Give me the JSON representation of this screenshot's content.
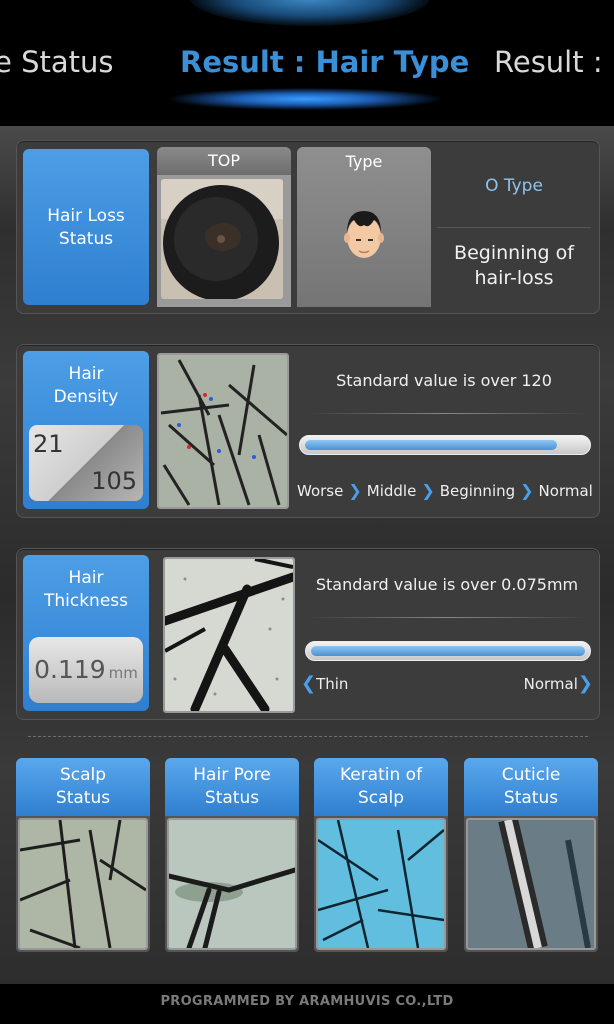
{
  "header": {
    "prev_tab": "le Status",
    "current_tab": "Result : Hair Type",
    "next_tab": "Result : H"
  },
  "hair_loss": {
    "label": "Hair Loss Status",
    "top_header": "TOP",
    "type_header": "Type",
    "type_value": "O Type",
    "stage": "Beginning of hair-loss"
  },
  "density": {
    "label": "Hair Density",
    "value_a": "21",
    "value_b": "105",
    "standard": "Standard value is over 120",
    "progress": 0.9,
    "scale": [
      "Worse",
      "Middle",
      "Beginning",
      "Normal"
    ]
  },
  "thickness": {
    "label": "Hair Thickness",
    "value": "0.119",
    "unit": "mm",
    "standard": "Standard value is over 0.075mm",
    "progress": 1.0,
    "left_end": "Thin",
    "right_end": "Normal"
  },
  "tiles": [
    {
      "label": "Scalp Status"
    },
    {
      "label": "Hair Pore Status"
    },
    {
      "label": "Keratin of Scalp"
    },
    {
      "label": "Cuticle Status"
    }
  ],
  "footer": "PROGRAMMED BY ARAMHUVIS CO.,LTD",
  "colors": {
    "accent": "#3a8fd6",
    "label_blue": "#4d9ee6",
    "bar_fill": "#4a92d4"
  }
}
